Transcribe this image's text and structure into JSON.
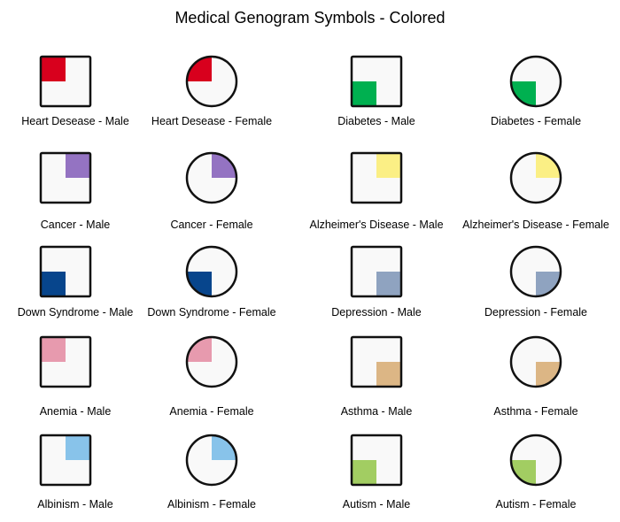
{
  "title": "Medical Genogram Symbols - Colored",
  "rows": [
    {
      "condition": "Heart Desease",
      "color": "#d8001d",
      "quadrant": "top-left",
      "male_label": "Heart Desease - Male",
      "female_label": "Heart Desease - Female"
    },
    {
      "condition": "Diabetes",
      "color": "#00b050",
      "quadrant": "bottom-left",
      "male_label": "Diabetes - Male",
      "female_label": "Diabetes - Female"
    },
    {
      "condition": "Cancer",
      "color": "#9473c2",
      "quadrant": "top-right",
      "male_label": "Cancer - Male",
      "female_label": "Cancer - Female"
    },
    {
      "condition": "Alzheimer's Disease",
      "color": "#fbef85",
      "quadrant": "top-right",
      "male_label": "Alzheimer's Disease - Male",
      "female_label": "Alzheimer's Disease - Female"
    },
    {
      "condition": "Down Syndrome",
      "color": "#07458c",
      "quadrant": "bottom-left",
      "male_label": "Down Syndrome - Male",
      "female_label": "Down Syndrome - Female"
    },
    {
      "condition": "Depression",
      "color": "#8fa3c0",
      "quadrant": "bottom-right",
      "male_label": "Depression - Male",
      "female_label": "Depression - Female"
    },
    {
      "condition": "Anemia",
      "color": "#e79aae",
      "quadrant": "top-left",
      "male_label": "Anemia - Male",
      "female_label": "Anemia - Female"
    },
    {
      "condition": "Asthma",
      "color": "#dcb685",
      "quadrant": "bottom-right",
      "male_label": "Asthma - Male",
      "female_label": "Asthma - Female"
    },
    {
      "condition": "Albinism",
      "color": "#88c3ea",
      "quadrant": "top-right",
      "male_label": "Albinism - Male",
      "female_label": "Albinism - Female"
    },
    {
      "condition": "Autism",
      "color": "#a2cd62",
      "quadrant": "bottom-left",
      "male_label": "Autism - Male",
      "female_label": "Autism - Female"
    }
  ],
  "colors": {
    "outline": "#111111",
    "symbol_fill": "#f9f9f9"
  }
}
